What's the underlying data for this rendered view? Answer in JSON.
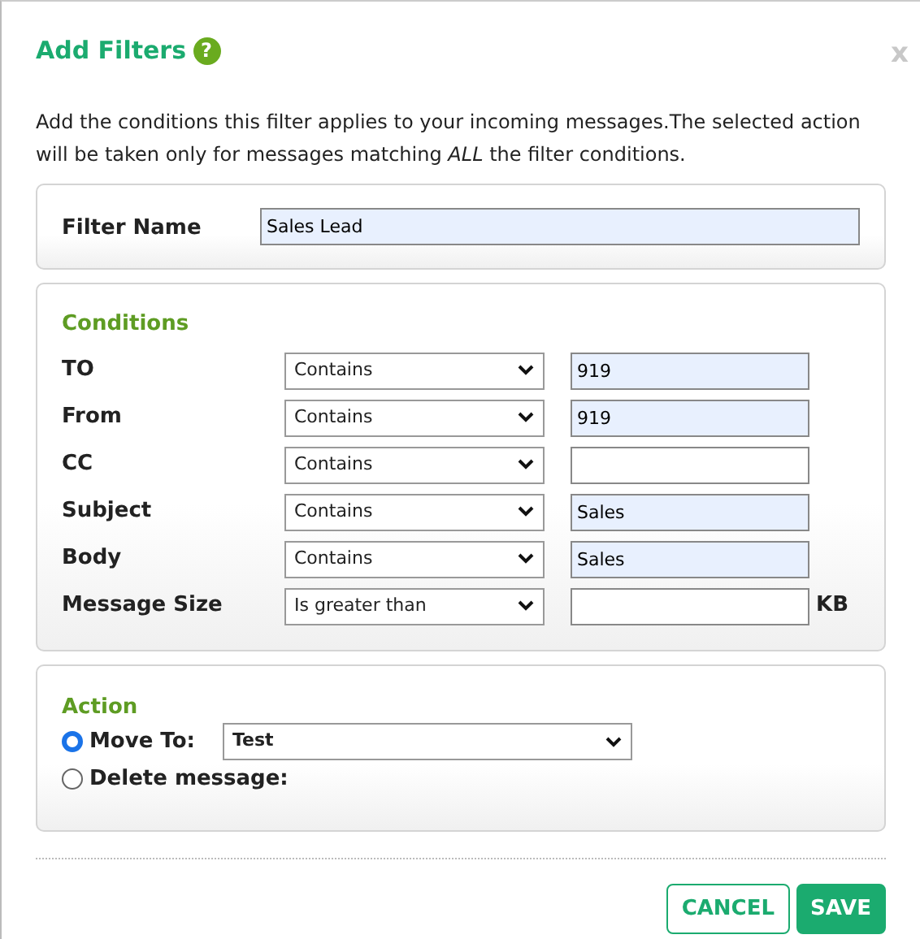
{
  "dialog": {
    "title": "Add Filters",
    "help_icon": "?",
    "close": "x"
  },
  "description": {
    "text": "Add the conditions this filter applies to your incoming messages.The selected action will be taken only for messages matching *ALL* the filter conditions."
  },
  "filter_name": {
    "label": "Filter Name",
    "value": "Sales Lead"
  },
  "conditions": {
    "heading": "Conditions",
    "rows": [
      {
        "label": "TO",
        "operator": "Contains",
        "value": "919"
      },
      {
        "label": "From",
        "operator": "Contains",
        "value": "919"
      },
      {
        "label": "CC",
        "operator": "Contains"
      },
      {
        "label": "Subject",
        "operator": "Contains",
        "value": "Sales"
      },
      {
        "label": "Body",
        "operator": "Contains",
        "value": "Sales"
      },
      {
        "label": "Message Size",
        "operator": "Is greater than",
        "unit": "KB"
      }
    ]
  },
  "action": {
    "heading": "Action",
    "options": [
      {
        "label": "Move To:",
        "selected": true,
        "folder": "Test"
      },
      {
        "label": "Delete message:",
        "selected": false
      }
    ]
  },
  "buttons": [
    {
      "label": "CANCEL",
      "kind": "secondary"
    },
    {
      "label": "SAVE",
      "kind": "primary"
    }
  ]
}
